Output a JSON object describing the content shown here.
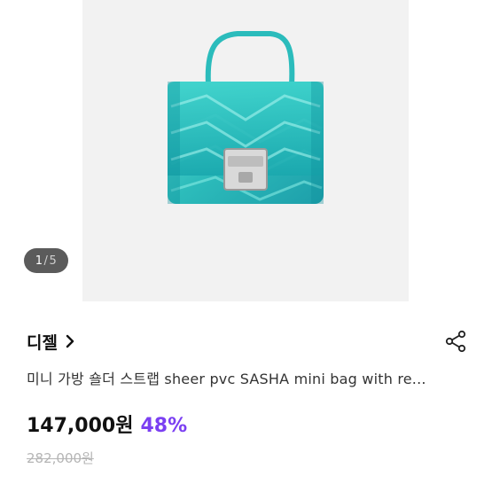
{
  "gallery": {
    "counter_current": "1",
    "counter_separator": "/",
    "counter_total": "5"
  },
  "seller": {
    "name": "디젤"
  },
  "product": {
    "title": "미니 가방 숄더 스트랩 sheer pvc SASHA mini bag with re...",
    "price": "147,000원",
    "discount": "48%",
    "original_price": "282,000원"
  },
  "icons": {
    "chevron": "chevron-right-icon",
    "share": "share-icon"
  },
  "colors": {
    "discount": "#7b3ff2",
    "bag": "#2ec4c0",
    "counter_bg": "#5b5b5b"
  }
}
